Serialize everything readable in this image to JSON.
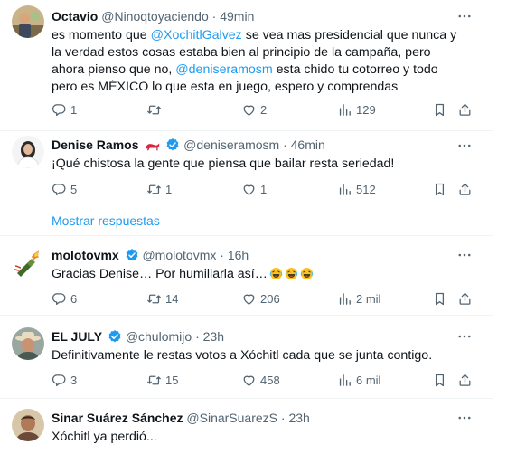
{
  "tweets": [
    {
      "name": "Octavio",
      "handle": "@Ninoqtoyaciendo",
      "sep": "·",
      "time": "49min",
      "text": {
        "p1": "es momento que ",
        "m1": "@XochitlGalvez",
        "p2": " se vea mas presidencial que nunca y la verdad estos cosas estaba bien al principio de la campaña, pero ahora pienso que no, ",
        "m2": "@deniseramosm",
        "p3": " esta chido tu cotorreo y todo pero es MÉXICO lo que esta en juego, espero y comprendas"
      },
      "replies": "1",
      "retweets": "",
      "likes": "2",
      "views": "129"
    },
    {
      "name": "Denise Ramos",
      "handle": "@deniseramosm",
      "sep": "·",
      "time": "46min",
      "text": "¡Qué chistosa la gente que piensa que bailar resta seriedad!",
      "replies": "5",
      "retweets": "1",
      "likes": "1",
      "views": "512",
      "show_replies": "Mostrar respuestas"
    },
    {
      "name": "molotovmx",
      "handle": "@molotovmx",
      "sep": "·",
      "time": "16h",
      "text": "Gracias Denise… Por humillarla así…",
      "replies": "6",
      "retweets": "14",
      "likes": "206",
      "views": "2 mil"
    },
    {
      "name": "EL JULY",
      "handle": "@chulomijo",
      "sep": "·",
      "time": "23h",
      "text": "Definitivamente le restas votos a Xóchitl cada que se junta contigo.",
      "replies": "3",
      "retweets": "15",
      "likes": "458",
      "views": "6 mil"
    },
    {
      "name": "Sinar Suárez Sánchez",
      "handle": "@SinarSuarezS",
      "sep": "·",
      "time": "23h",
      "text": "Xóchitl ya perdió..."
    }
  ],
  "colors": {
    "accent": "#1d9bf0",
    "secondary_text": "#536471",
    "primary_text": "#0f1419",
    "divider": "#eff3f4"
  },
  "icons": [
    "more-icon",
    "reply-icon",
    "retweet-icon",
    "like-icon",
    "views-icon",
    "bookmark-icon",
    "share-icon",
    "verified-badge-icon",
    "high-heel-emoji",
    "laughing-emoji"
  ]
}
